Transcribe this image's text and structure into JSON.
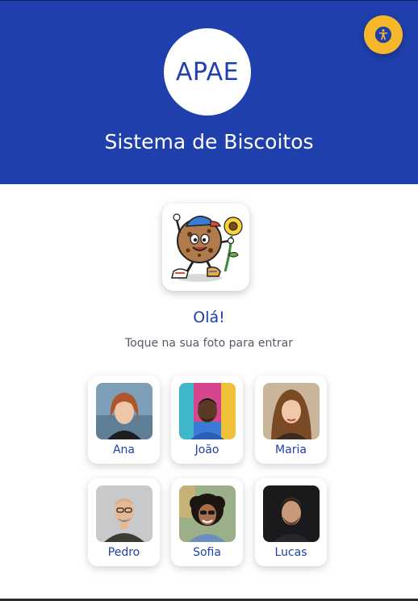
{
  "header": {
    "logo_text": "APAE",
    "title": "Sistema de Biscoitos",
    "background_color": "#1f3fad",
    "accessibility_button_color": "#f6b82a"
  },
  "welcome": {
    "mascot": "cookie-mascot-with-sunflower",
    "greeting": "Olá!",
    "instruction": "Toque na sua foto para entrar"
  },
  "users": [
    {
      "name": "Ana"
    },
    {
      "name": "João"
    },
    {
      "name": "Maria"
    },
    {
      "name": "Pedro"
    },
    {
      "name": "Sofia"
    },
    {
      "name": "Lucas"
    }
  ]
}
